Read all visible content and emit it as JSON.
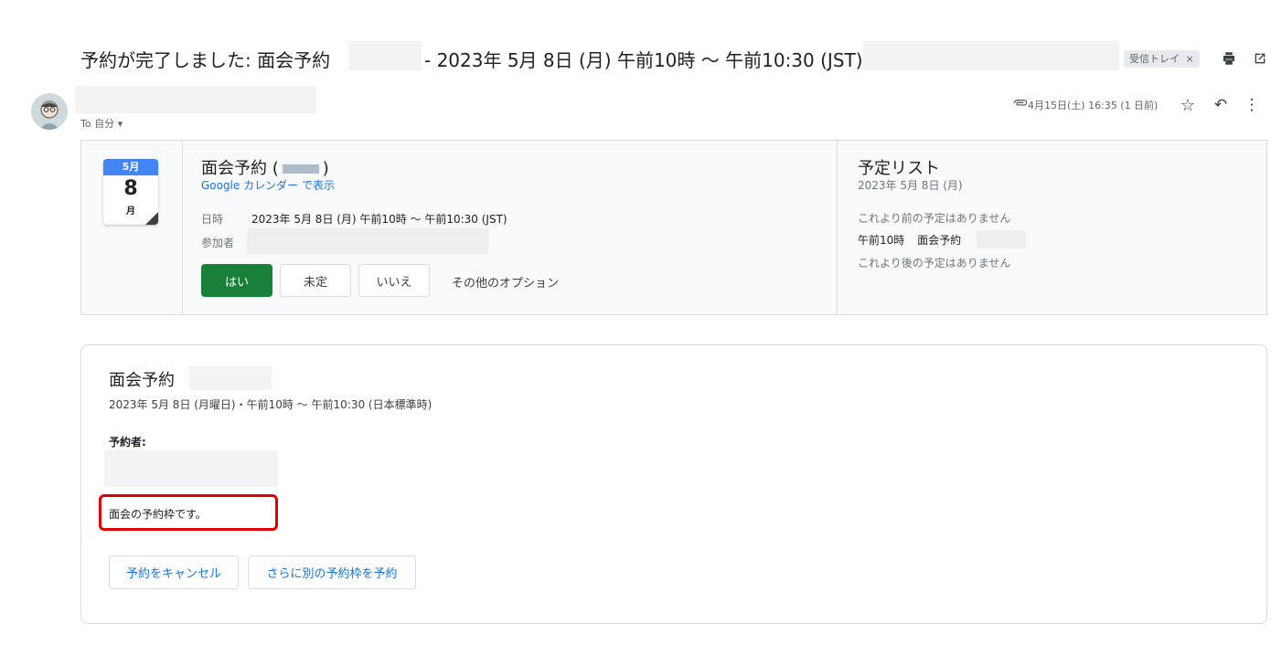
{
  "header": {
    "subject_prefix": "予約が完了しました: 面会予約",
    "subject_time": "- 2023年 5月 8日 (月) 午前10時 ～ 午前10:30 (JST)",
    "inbox_label": "受信トレイ",
    "inbox_remove": "×",
    "print_icon": "⎙",
    "open_new_window_icon": "⧉"
  },
  "message_meta": {
    "to_label": "To 自分 ▾",
    "attachment_icon": "paperclip",
    "date": "4月15日(土) 16:35 (1 日前)",
    "star_icon": "☆",
    "reply_icon": "↶",
    "more_icon": "⋮"
  },
  "invite": {
    "cal_month": "5月",
    "cal_day": "8",
    "cal_weekday": "月",
    "event_title": "面会予約 (",
    "event_title_suffix": ")",
    "view_in_calendar": "Google カレンダー で表示",
    "when_label": "日時",
    "when_value": "2023年 5月 8日 (月) 午前10時 ～ 午前10:30 (JST)",
    "guests_label": "参加者",
    "rsvp_yes": "はい",
    "rsvp_maybe": "未定",
    "rsvp_no": "いいえ",
    "more_options": "その他のオプション"
  },
  "agenda": {
    "title": "予定リスト",
    "date": "2023年 5月 8日 (月)",
    "before_text": "これより前の予定はありません",
    "item_time": "午前10時",
    "item_title": "面会予約",
    "after_text": "これより後の予定はありません"
  },
  "booking": {
    "title": "面会予約",
    "when": "2023年 5月 8日 (月曜日)・午前10時 ～ 午前10:30 (日本標準時)",
    "booked_by_label": "予約者:",
    "description": "面会の予約枠です。",
    "cancel_button": "予約をキャンセル",
    "book_another_button": "さらに別の予約枠を予約"
  },
  "colors": {
    "link": "#1a73e8",
    "rsvp_yes_bg": "#188038",
    "calendar_blue": "#4285f4",
    "highlight_red": "#e00000"
  }
}
